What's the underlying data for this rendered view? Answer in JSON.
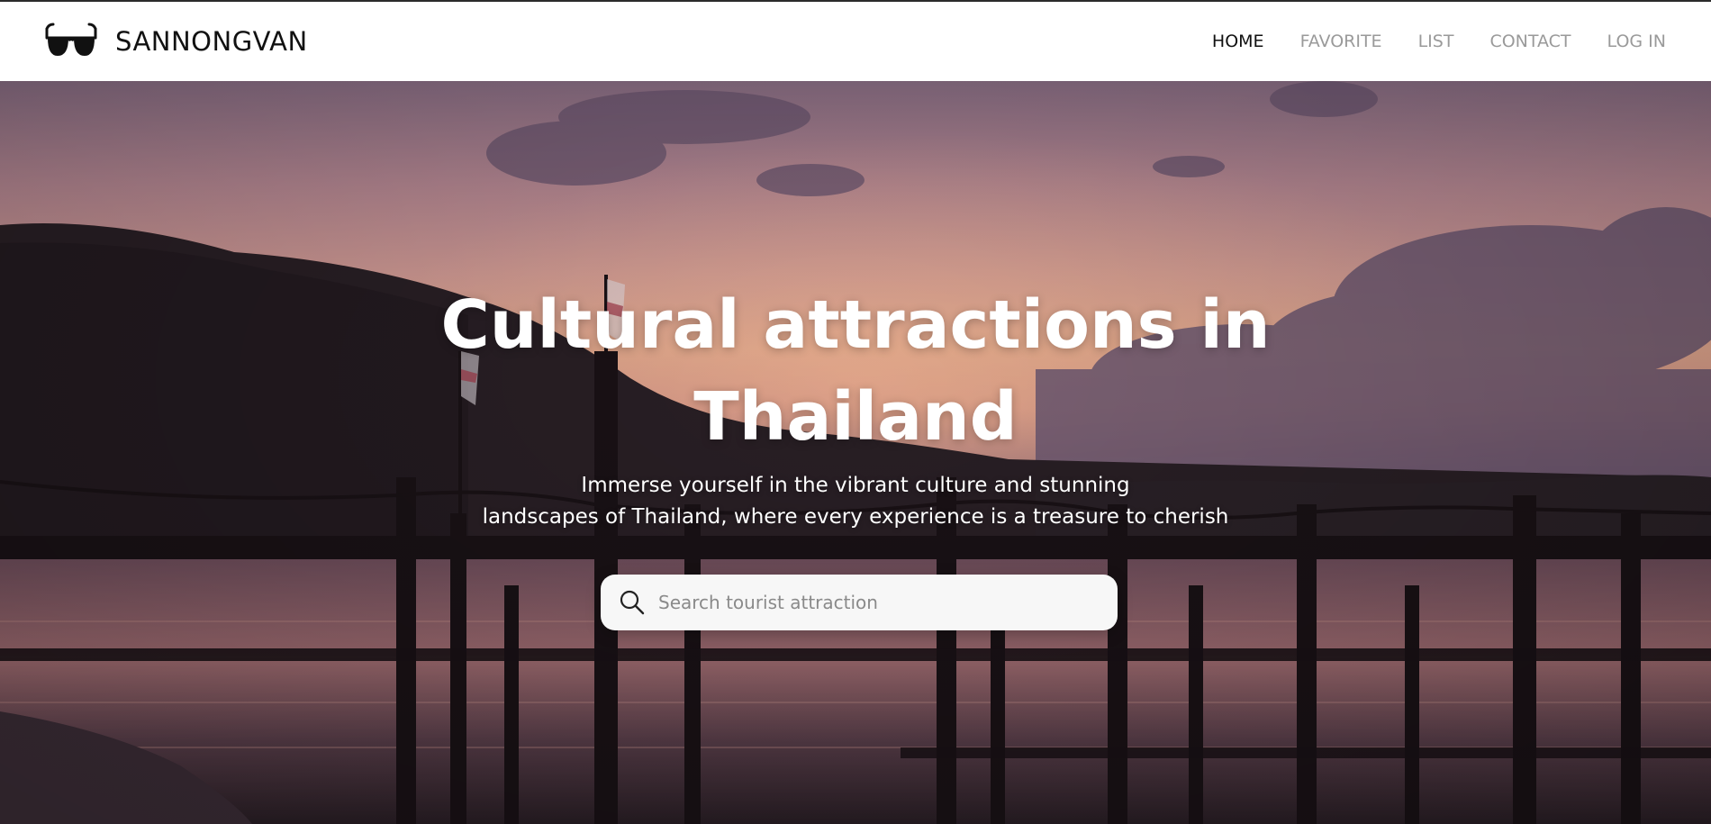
{
  "brand": {
    "logo_icon": "sunglasses-icon",
    "name": "SANNONGVAN"
  },
  "nav": {
    "items": [
      {
        "label": "HOME",
        "active": true
      },
      {
        "label": "FAVORITE",
        "active": false
      },
      {
        "label": "LIST",
        "active": false
      },
      {
        "label": "CONTACT",
        "active": false
      },
      {
        "label": "LOG IN",
        "active": false
      }
    ]
  },
  "hero": {
    "title_line1": "Cultural attractions in",
    "title_line2": "Thailand",
    "subtitle_line1": "Immerse yourself in the vibrant culture and stunning",
    "subtitle_line2": "landscapes of Thailand, where every experience is a treasure to cherish",
    "background": "sunset-pier-photo"
  },
  "search": {
    "icon": "search-icon",
    "placeholder": "Search tourist attraction",
    "value": ""
  },
  "colors": {
    "nav_active": "#111111",
    "nav_inactive": "#9a9a9a",
    "text_on_hero": "#ffffff"
  }
}
